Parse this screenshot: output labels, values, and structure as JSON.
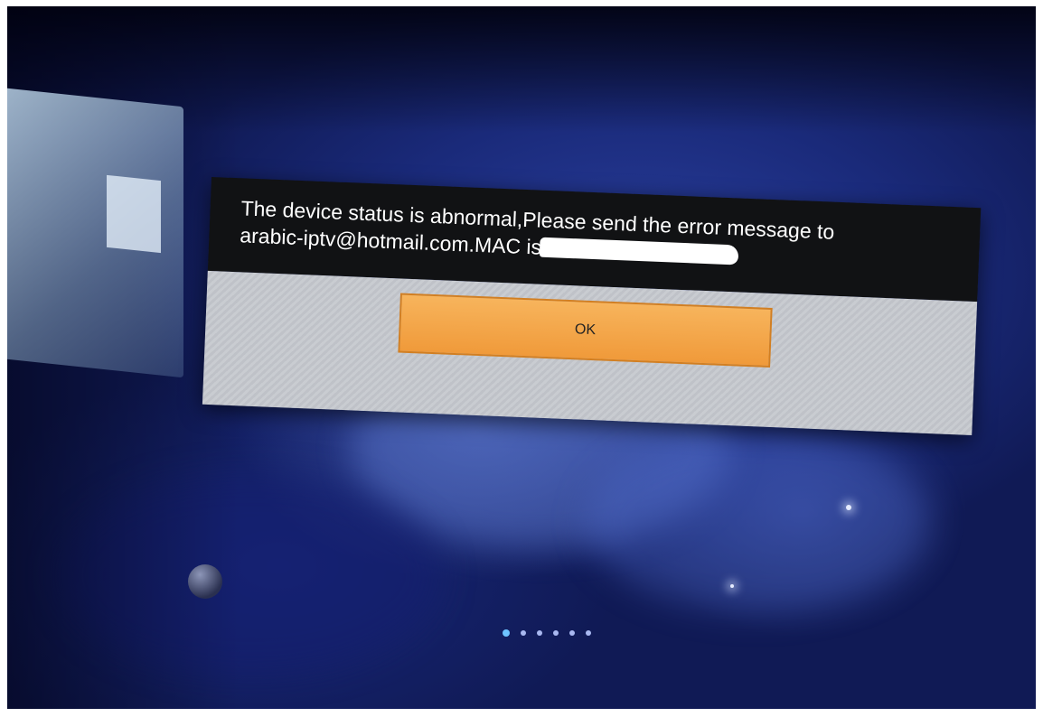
{
  "dialog": {
    "message_line1": "The device status is abnormal,Please send the error message to",
    "message_line2": "arabic-iptv@hotmail.com.MAC is:",
    "ok_label": "OK"
  },
  "pager": {
    "total_pages": 6,
    "active_page": 1
  },
  "colors": {
    "button_fill": "#f0a040",
    "dialog_bg": "#111214",
    "actions_bg": "#c9ccd1"
  }
}
